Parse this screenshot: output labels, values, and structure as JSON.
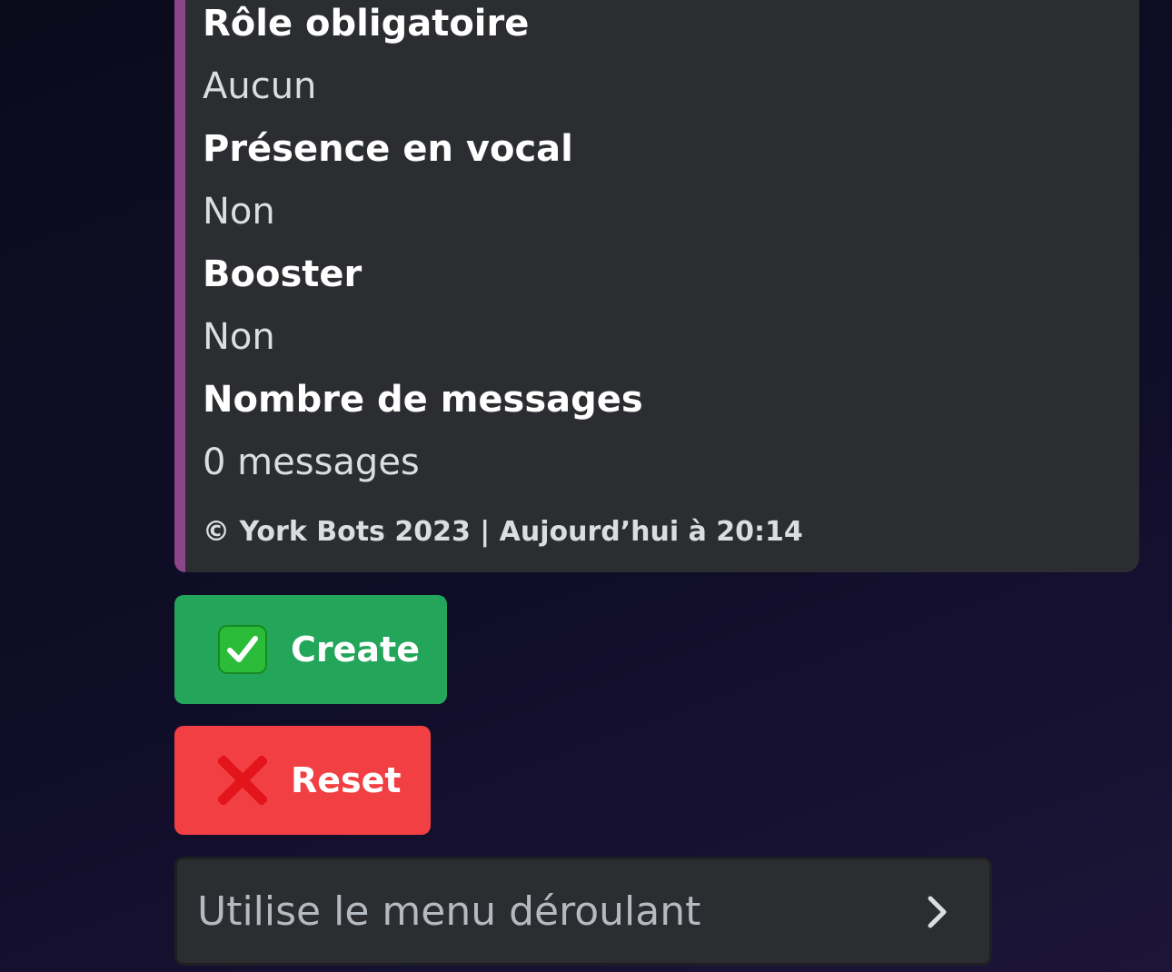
{
  "embed": {
    "accent_color": "#8b4589",
    "fields": [
      {
        "name": "Rôle obligatoire",
        "value": "Aucun"
      },
      {
        "name": "Présence en vocal",
        "value": "Non"
      },
      {
        "name": "Booster",
        "value": "Non"
      },
      {
        "name": "Nombre de messages",
        "value": "0 messages"
      }
    ],
    "footer": "© York Bots 2023 | Aujourd’hui à 20:14"
  },
  "buttons": {
    "create": {
      "label": "Create",
      "icon": "white-check-mark-icon",
      "color": "#23a55a"
    },
    "reset": {
      "label": "Reset",
      "icon": "red-cross-icon",
      "color": "#f23f43"
    }
  },
  "select_menu": {
    "placeholder": "Utilise le menu déroulant",
    "icon": "chevron-right-icon"
  }
}
